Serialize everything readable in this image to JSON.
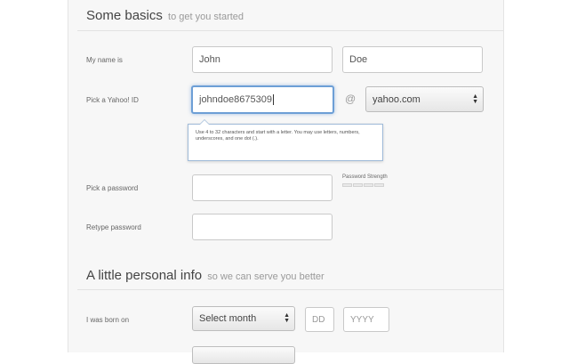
{
  "basics": {
    "title": "Some basics",
    "subtitle": "to get you started"
  },
  "name_row": {
    "label": "My name is",
    "first_name_value": "John",
    "last_name_value": "Doe"
  },
  "yahoo_id_row": {
    "label": "Pick a Yahoo! ID",
    "id_value": "johndoe8675309",
    "at_symbol": "@",
    "domain_selected": "yahoo.com",
    "tooltip": "Use 4 to 32 characters and start with a letter. You may use letters, numbers, underscores, and one dot (.)."
  },
  "password_row": {
    "label": "Pick a password",
    "strength_label": "Password Strength"
  },
  "retype_row": {
    "label": "Retype password"
  },
  "personal": {
    "title": "A little personal info",
    "subtitle": "so we can serve you better"
  },
  "born_row": {
    "label": "I was born on",
    "month_selected": "Select month",
    "day_placeholder": "DD",
    "year_placeholder": "YYYY"
  }
}
